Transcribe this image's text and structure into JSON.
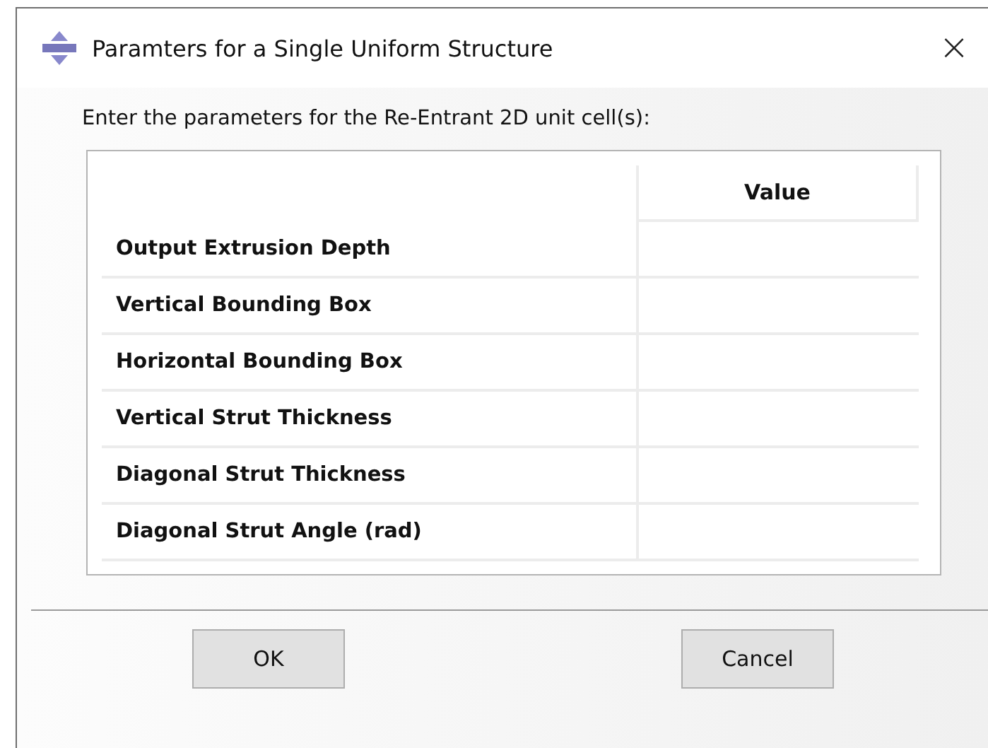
{
  "window": {
    "title": "Paramters for a Single Uniform Structure",
    "close": "×"
  },
  "prompt": "Enter the parameters for the Re-Entrant 2D unit cell(s):",
  "table": {
    "columns": [
      "Value"
    ],
    "rows": [
      {
        "label": "Output Extrusion Depth"
      },
      {
        "label": "Vertical Bounding Box"
      },
      {
        "label": "Horizontal Bounding Box"
      },
      {
        "label": "Vertical Strut Thickness"
      },
      {
        "label": "Diagonal Strut Thickness"
      },
      {
        "label": "Diagonal Strut Angle (rad)"
      }
    ]
  },
  "buttons": [
    "OK",
    "Cancel"
  ]
}
